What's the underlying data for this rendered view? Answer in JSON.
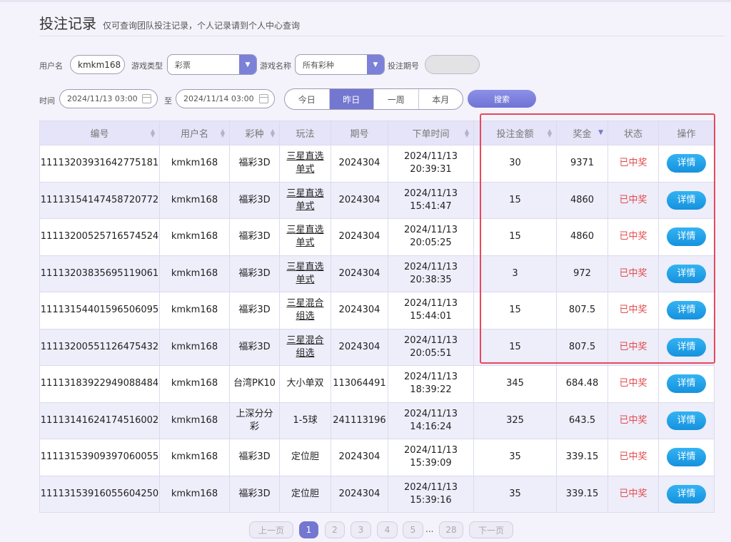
{
  "page": {
    "title": "投注记录",
    "subtitle": "仅可查询团队投注记录，个人记录请到个人中心查询"
  },
  "filters": {
    "username_label": "用户名",
    "username_value": "kmkm168",
    "game_type_label": "游戏类型",
    "game_type_value": "彩票",
    "game_name_label": "游戏名称",
    "game_name_value": "所有彩种",
    "issue_label": "投注期号",
    "issue_value": "",
    "time_label": "时间",
    "start_time": "2024/11/13 03:00",
    "to_label": "至",
    "end_time": "2024/11/14 03:00",
    "quick_ranges": [
      "今日",
      "昨日",
      "一周",
      "本月"
    ],
    "active_range": "昨日",
    "search_label": "搜索"
  },
  "table": {
    "headers": [
      "编号",
      "用户名",
      "彩种",
      "玩法",
      "期号",
      "下单时间",
      "投注金额",
      "奖金",
      "状态",
      "操作"
    ],
    "rows": [
      [
        "11113203931642775181",
        "kmkm168",
        "福彩3D",
        "三星直选\n单式",
        "2024304",
        "2024/11/13\n20:39:31",
        "30",
        "9371",
        "已中奖",
        "详情"
      ],
      [
        "11113154147458720772",
        "kmkm168",
        "福彩3D",
        "三星直选\n单式",
        "2024304",
        "2024/11/13\n15:41:47",
        "15",
        "4860",
        "已中奖",
        "详情"
      ],
      [
        "11113200525716574524",
        "kmkm168",
        "福彩3D",
        "三星直选\n单式",
        "2024304",
        "2024/11/13\n20:05:25",
        "15",
        "4860",
        "已中奖",
        "详情"
      ],
      [
        "11113203835695119061",
        "kmkm168",
        "福彩3D",
        "三星直选\n单式",
        "2024304",
        "2024/11/13\n20:38:35",
        "3",
        "972",
        "已中奖",
        "详情"
      ],
      [
        "11113154401596506095",
        "kmkm168",
        "福彩3D",
        "三星混合\n组选",
        "2024304",
        "2024/11/13\n15:44:01",
        "15",
        "807.5",
        "已中奖",
        "详情"
      ],
      [
        "11113200551126475432",
        "kmkm168",
        "福彩3D",
        "三星混合\n组选",
        "2024304",
        "2024/11/13\n20:05:51",
        "15",
        "807.5",
        "已中奖",
        "详情"
      ],
      [
        "11113183922949088484",
        "kmkm168",
        "台湾PK10",
        "大小单双",
        "113064491",
        "2024/11/13\n18:39:22",
        "345",
        "684.48",
        "已中奖",
        "详情"
      ],
      [
        "11113141624174516002",
        "kmkm168",
        "上深分分\n彩",
        "1-5球",
        "241113196",
        "2024/11/13\n14:16:24",
        "325",
        "643.5",
        "已中奖",
        "详情"
      ],
      [
        "11113153909397060055",
        "kmkm168",
        "福彩3D",
        "定位胆",
        "2024304",
        "2024/11/13\n15:39:09",
        "35",
        "339.15",
        "已中奖",
        "详情"
      ],
      [
        "11113153916055604250",
        "kmkm168",
        "福彩3D",
        "定位胆",
        "2024304",
        "2024/11/13\n15:39:16",
        "35",
        "339.15",
        "已中奖",
        "详情"
      ]
    ]
  },
  "pagination": {
    "prev": "上一页",
    "next": "下一页",
    "pages": [
      "1",
      "2",
      "3",
      "4",
      "5",
      "28"
    ],
    "ellipsis": "...",
    "current": "1"
  },
  "colors": {
    "accent": "#7377cf",
    "won": "#e24a4a",
    "detail_button": "#1e9fe6",
    "highlight": "#e8485c"
  }
}
